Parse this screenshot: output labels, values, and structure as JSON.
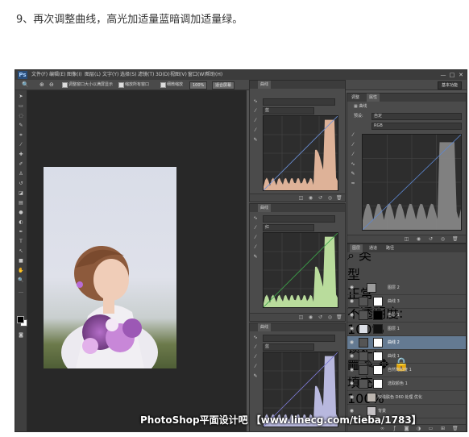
{
  "step_text": "9、再次调整曲线，高光加适量蓝暗调加适量绿。",
  "app": {
    "logo": "Ps",
    "menus": [
      "文件(F)",
      "编辑(E)",
      "图像(I)",
      "图层(L)",
      "文字(Y)",
      "选择(S)",
      "滤镜(T)",
      "3D(D)",
      "视图(V)",
      "窗口(W)",
      "帮助(H)"
    ],
    "window_buttons": [
      "—",
      "□",
      "✕"
    ]
  },
  "options_bar": {
    "resize_windows": "调整窗口大小以满屏显示",
    "zoom_all": "缩放所有窗口",
    "scrubby_zoom": "细微缩放",
    "zoom_level": "100%",
    "fit_screen": "适合屏幕",
    "workspace": "基本功能"
  },
  "curves_panels": [
    {
      "title": "曲线",
      "channel": "蓝",
      "histogram_color": "#f2c1a4"
    },
    {
      "title": "曲线",
      "channel": "红",
      "histogram_color": "#c9f0a8"
    },
    {
      "title": "曲线",
      "channel": "蓝",
      "histogram_color": "#c8c8f2"
    }
  ],
  "properties_panel": {
    "tabs": [
      "调整",
      "属性"
    ],
    "title": "曲线",
    "preset_label": "预设:",
    "preset_value": "自定",
    "channel_value": "RGB"
  },
  "layers_panel": {
    "tabs": [
      "图层",
      "通道",
      "路径"
    ],
    "filter_type": "类型",
    "blend_mode": "正常",
    "opacity_label": "不透明度:",
    "opacity_value": "100%",
    "lock_label": "锁定:",
    "fill_label": "填充:",
    "fill_value": "100%",
    "layers": [
      {
        "name": "图层 2",
        "active": false
      },
      {
        "name": "曲线 3",
        "active": false
      },
      {
        "name": "色阶 1",
        "active": false
      },
      {
        "name": "图层 1",
        "active": false
      },
      {
        "name": "曲线 2",
        "active": true
      },
      {
        "name": "曲线 1",
        "active": false
      },
      {
        "name": "自然饱和度 1",
        "active": false
      },
      {
        "name": "选取颜色 1",
        "active": false
      },
      {
        "name": "较浅肤色 D60 处理 优化",
        "active": false
      },
      {
        "name": "背景",
        "active": false
      }
    ]
  },
  "watermark": "PhotoShop平面设计吧 【www.linecg.com/tieba/1783】"
}
